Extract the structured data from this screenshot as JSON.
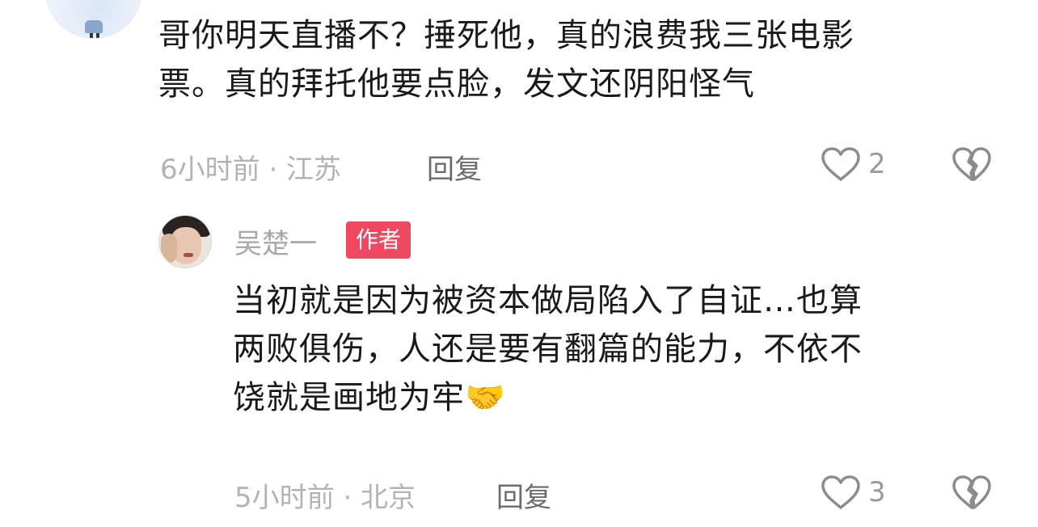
{
  "comments": [
    {
      "text_line1": "哥你明天直播不？捶死他，真的浪费我三张电影",
      "text_line2": "票。真的拜托他要点脸，发文还阴阳怪气",
      "meta": "6小时前 · 江苏",
      "reply_label": "回复",
      "like_count": "2",
      "like_icon": "heart-outline-icon",
      "dislike_icon": "broken-heart-icon"
    },
    {
      "author": "吴楚一",
      "author_badge": "作者",
      "text_line1": "当初就是因为被资本做局陷入了自证…也算",
      "text_line2": "两败俱伤，人还是要有翻篇的能力，不依不",
      "text_line3": "饶就是画地为牢",
      "text_emoji": "🤝",
      "meta": "5小时前 · 北京",
      "reply_label": "回复",
      "like_count": "3",
      "like_icon": "heart-outline-icon",
      "dislike_icon": "broken-heart-icon"
    }
  ],
  "colors": {
    "badge_bg": "#f04860",
    "meta_text": "#b3b3b3",
    "reply_text": "#6b6b6b",
    "icon_stroke": "#8c8c8c"
  }
}
